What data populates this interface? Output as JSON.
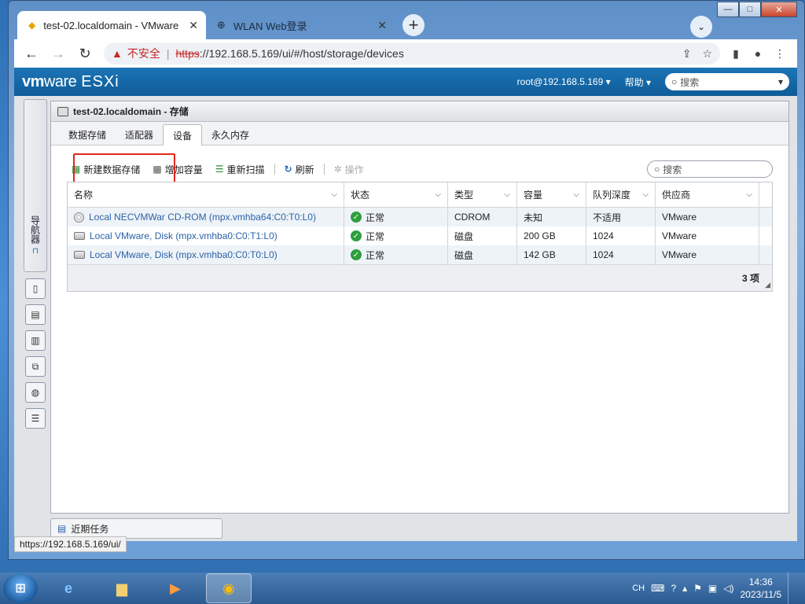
{
  "browser": {
    "tabs": [
      {
        "title": "test-02.localdomain - VMware",
        "active": true
      },
      {
        "title": "WLAN Web登录",
        "active": false
      }
    ],
    "new_tab": "+",
    "close_glyph": "✕",
    "insecure_label": "不安全",
    "url_scheme": "https",
    "url_rest": "://192.168.5.169/ui/#/host/storage/devices",
    "window_controls": {
      "minimize": "—",
      "maximize": "□",
      "close": "✕"
    }
  },
  "esxi": {
    "logo_vm": "vm",
    "logo_ware": "ware",
    "logo_esxi": "ESXi",
    "user": "root@192.168.5.169",
    "help": "帮助",
    "search_placeholder": "搜索"
  },
  "navigator": {
    "label": "导航器"
  },
  "panel": {
    "title": "test-02.localdomain - 存储",
    "subtabs": [
      "数据存储",
      "适配器",
      "设备",
      "永久内存"
    ],
    "active_subtab": 2
  },
  "actions": {
    "new_datastore": "新建数据存储",
    "increase_capacity": "增加容量",
    "rescan": "重新扫描",
    "refresh": "刷新",
    "actions": "操作",
    "search_placeholder": "搜索"
  },
  "table": {
    "columns": [
      "名称",
      "状态",
      "类型",
      "容量",
      "队列深度",
      "供应商"
    ],
    "rows": [
      {
        "name": "Local NECVMWar CD-ROM (mpx.vmhba64:C0:T0:L0)",
        "status": "正常",
        "type": "CDROM",
        "capacity": "未知",
        "queue": "不适用",
        "vendor": "VMware",
        "kind": "cdrom"
      },
      {
        "name": "Local VMware, Disk (mpx.vmhba0:C0:T1:L0)",
        "status": "正常",
        "type": "磁盘",
        "capacity": "200 GB",
        "queue": "1024",
        "vendor": "VMware",
        "kind": "disk"
      },
      {
        "name": "Local VMware, Disk (mpx.vmhba0:C0:T0:L0)",
        "status": "正常",
        "type": "磁盘",
        "capacity": "142 GB",
        "queue": "1024",
        "vendor": "VMware",
        "kind": "disk"
      }
    ],
    "footer_count": "3 项"
  },
  "recent_tasks": "近期任务",
  "status_url": "https://192.168.5.169/ui/",
  "taskbar": {
    "ime": "CH",
    "time": "14:36",
    "date": "2023/11/5"
  }
}
